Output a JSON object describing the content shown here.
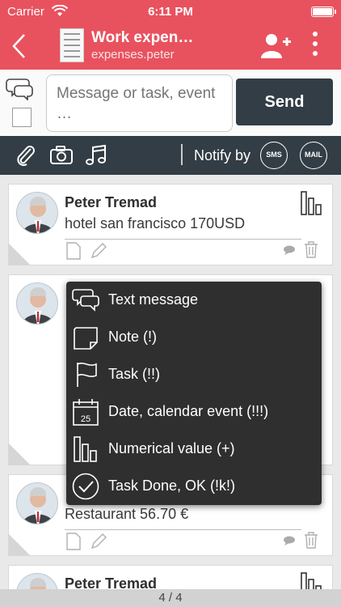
{
  "status": {
    "carrier": "Carrier",
    "time": "6:11 PM"
  },
  "nav": {
    "title": "Work expen…",
    "subtitle": "expenses.peter"
  },
  "compose": {
    "placeholder": "Message or task, event …",
    "send_label": "Send"
  },
  "toolbar": {
    "notify_label": "Notify by",
    "sms_label": "SMS",
    "mail_label": "MAIL"
  },
  "messages": [
    {
      "author": "Peter Tremad",
      "text": "hotel san francisco 170USD"
    },
    {
      "author": "",
      "text": ""
    },
    {
      "author": "",
      "text": "Restaurant 56.70 €"
    },
    {
      "author": "Peter Tremad",
      "text": ""
    }
  ],
  "menu": {
    "items": [
      {
        "label": "Text message",
        "icon": "chat-bubbles-icon"
      },
      {
        "label": "Note (!)",
        "icon": "note-icon"
      },
      {
        "label": "Task (!!)",
        "icon": "flag-icon"
      },
      {
        "label": "Date, calendar event (!!!)",
        "icon": "calendar-icon",
        "calendar_day": "25"
      },
      {
        "label": "Numerical value (+)",
        "icon": "bar-chart-icon"
      },
      {
        "label": "Task Done, OK (!k!)",
        "icon": "check-circle-icon"
      }
    ]
  },
  "pager": {
    "text": "4 / 4"
  },
  "colors": {
    "accent": "#e8525e",
    "toolbar": "#323d45",
    "menu": "#2f2f2f"
  }
}
